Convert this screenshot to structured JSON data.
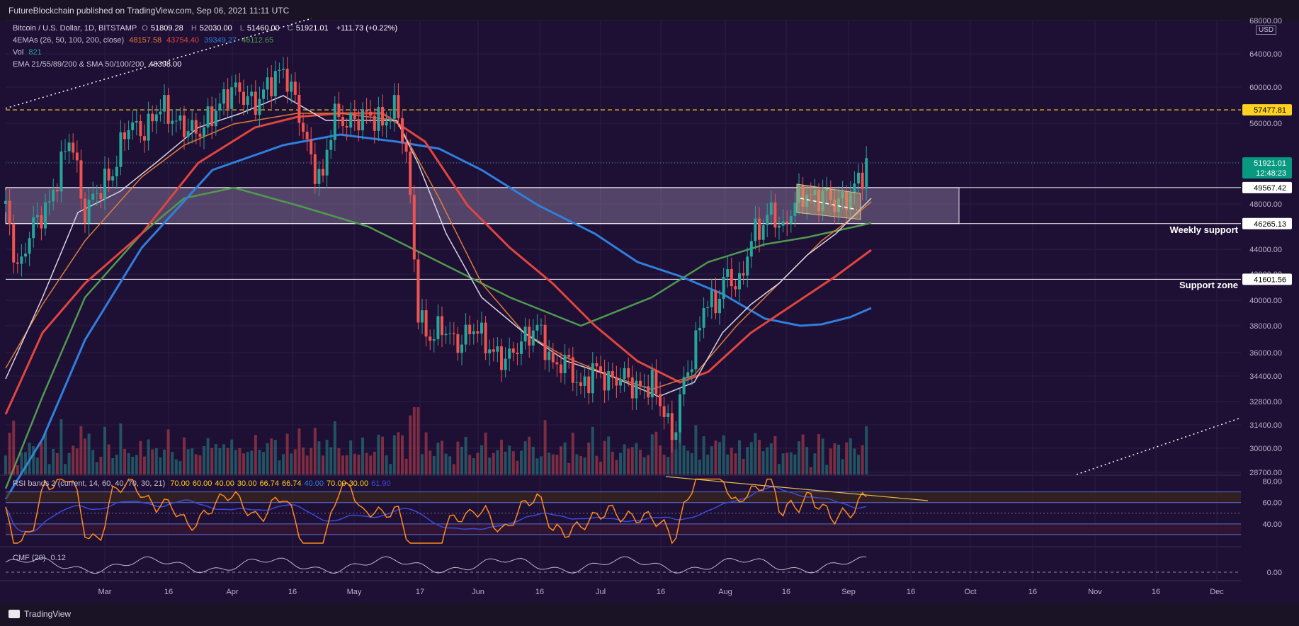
{
  "publisher": "FutureBlockchain published on TradingView.com, Sep 06, 2021 11:11 UTC",
  "watermark": "TradingView",
  "legend": {
    "symbol": "Bitcoin / U.S. Dollar, 1D, BITSTAMP",
    "o_label": "O",
    "o": "51809.28",
    "h_label": "H",
    "h": "52030.00",
    "l_label": "L",
    "l": "51460.00",
    "c_label": "C",
    "c": "51921.01",
    "chg": "+111.73 (+0.22%)",
    "emas_label": "4EMAs (26, 50, 100, 200, close)",
    "ema26": "48157.58",
    "ema50": "43754.40",
    "ema100": "39349.27",
    "ema200": "46112.65",
    "vol_label": "Vol",
    "vol": "821",
    "ema_sma_label": "EMA 21/55/89/200 & SMA 50/100/200",
    "ema_sma_value": "48398.00",
    "rsi_label": "RSI bands 2 (current, 14, 60, 40, 70, 30, 21)",
    "rsi_values": [
      "70.00",
      "60.00",
      "40.00",
      "30.00",
      "66.74",
      "66.74",
      "40.00",
      "70.00",
      "30.00",
      "61.90"
    ],
    "cmf_label": "CMF (20)",
    "cmf_value": "0.12"
  },
  "currency": "USD",
  "annotations": {
    "weekly": "Weekly support",
    "support": "Support zone"
  },
  "chart_data": {
    "type": "candlestick",
    "title": "Bitcoin / U.S. Dollar, 1D, BITSTAMP",
    "x_ticks": [
      "Mar",
      "16",
      "Apr",
      "16",
      "May",
      "17",
      "Jun",
      "16",
      "Jul",
      "16",
      "Aug",
      "16",
      "Sep",
      "16",
      "Oct",
      "16",
      "Nov",
      "16",
      "Dec"
    ],
    "y_ticks": [
      68000,
      64000,
      60000,
      56000,
      52000,
      48000,
      44000,
      42000,
      40000,
      38000,
      36000,
      34400,
      32800,
      31400,
      30000,
      28700
    ],
    "price_tags": [
      {
        "label": "57477.81",
        "color": "#ffd21f",
        "text_color": "#000000"
      },
      {
        "label": "51921.01",
        "color": "#089981",
        "text_color": "#ffffff",
        "sub": "12:48:23"
      },
      {
        "label": "49567.42",
        "color": "#ffffff",
        "text_color": "#000000"
      },
      {
        "label": "46265.13",
        "color": "#ffffff",
        "text_color": "#000000"
      },
      {
        "label": "41601.56",
        "color": "#ffffff",
        "text_color": "#000000"
      }
    ],
    "levels": {
      "resistance_dashed": 57477.81,
      "zone_top": 49567.42,
      "zone_bottom": 46265.13,
      "support": 41601.56,
      "last": 51921.01
    },
    "colors": {
      "up": "#26a69a",
      "down": "#ef5350",
      "ema26": "#d8d4e2",
      "ema50": "#e07b39",
      "ema100": "#e0463e",
      "ema200": "#2f7fdc",
      "sma200": "#4f9a4f",
      "zone": "#b7a6c8",
      "rsi": "#ff8a1e",
      "rsi_ma": "#3b4bd8",
      "cmf": "#bcb6cc"
    },
    "rsi_axis": [
      80,
      60,
      40
    ],
    "cmf_axis": [
      "0.00"
    ]
  }
}
